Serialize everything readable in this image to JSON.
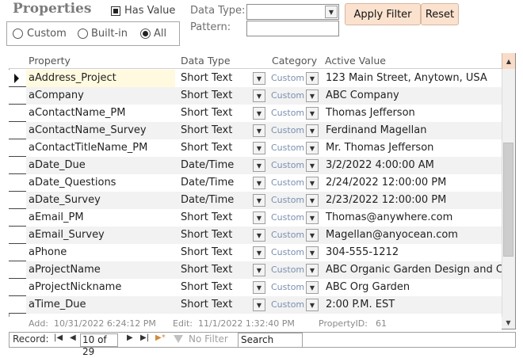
{
  "header": {
    "title": "Properties",
    "has_value_label": "Has Value",
    "has_value_checked": true,
    "filter_options": [
      "Custom",
      "Built-in",
      "All"
    ],
    "filter_selected": "All",
    "data_type_label": "Data Type:",
    "data_type_value": "",
    "pattern_label": "Pattern:",
    "pattern_value": "",
    "apply_filter_label": "Apply Filter",
    "reset_label": "Reset"
  },
  "table": {
    "columns": [
      "Property",
      "Data Type",
      "Category",
      "Active Value"
    ],
    "rows": [
      {
        "property": "aAddress_Project",
        "type": "Short Text",
        "category": "Custom",
        "value": "123 Main Street, Anytown, USA"
      },
      {
        "property": "aCompany",
        "type": "Short Text",
        "category": "Custom",
        "value": "ABC Company"
      },
      {
        "property": "aContactName_PM",
        "type": "Short Text",
        "category": "Custom",
        "value": "Thomas Jefferson"
      },
      {
        "property": "aContactName_Survey",
        "type": "Short Text",
        "category": "Custom",
        "value": "Ferdinand Magellan"
      },
      {
        "property": "aContactTitleName_PM",
        "type": "Short Text",
        "category": "Custom",
        "value": "Mr. Thomas Jefferson"
      },
      {
        "property": "aDate_Due",
        "type": "Date/Time",
        "category": "Custom",
        "value": "3/2/2022 4:00:00 AM"
      },
      {
        "property": "aDate_Questions",
        "type": "Date/Time",
        "category": "Custom",
        "value": "2/24/2022 12:00:00 PM"
      },
      {
        "property": "aDate_Survey",
        "type": "Date/Time",
        "category": "Custom",
        "value": "2/23/2022 12:00:00 PM"
      },
      {
        "property": "aEmail_PM",
        "type": "Short Text",
        "category": "Custom",
        "value": "Thomas@anywhere.com"
      },
      {
        "property": "aEmail_Survey",
        "type": "Short Text",
        "category": "Custom",
        "value": "Magellan@anyocean.com"
      },
      {
        "property": "aPhone",
        "type": "Short Text",
        "category": "Custom",
        "value": "304-555-1212"
      },
      {
        "property": "aProjectName",
        "type": "Short Text",
        "category": "Custom",
        "value": "ABC Organic Garden Design and C"
      },
      {
        "property": "aProjectNickname",
        "type": "Short Text",
        "category": "Custom",
        "value": "ABC Org Garden"
      },
      {
        "property": "aTime_Due",
        "type": "Short Text",
        "category": "Custom",
        "value": "2:00 P.M.  EST"
      }
    ]
  },
  "footer": {
    "add_label": "Add:",
    "add_value": "10/31/2022 6:24:12 PM",
    "edit_label": "Edit:",
    "edit_value": "11/1/2022 1:32:40 PM",
    "property_id_label": "PropertyID:",
    "property_id_value": "61"
  },
  "navigation": {
    "record_label": "Record:",
    "position": "10 of 29",
    "no_filter_label": "No Filter",
    "search_value": "Search"
  },
  "colors": {
    "button_bg": "#fbe2cf",
    "title_gray": "#7b7b7b",
    "category_text": "#7a8fb0",
    "selected_row": "#fffadf"
  }
}
